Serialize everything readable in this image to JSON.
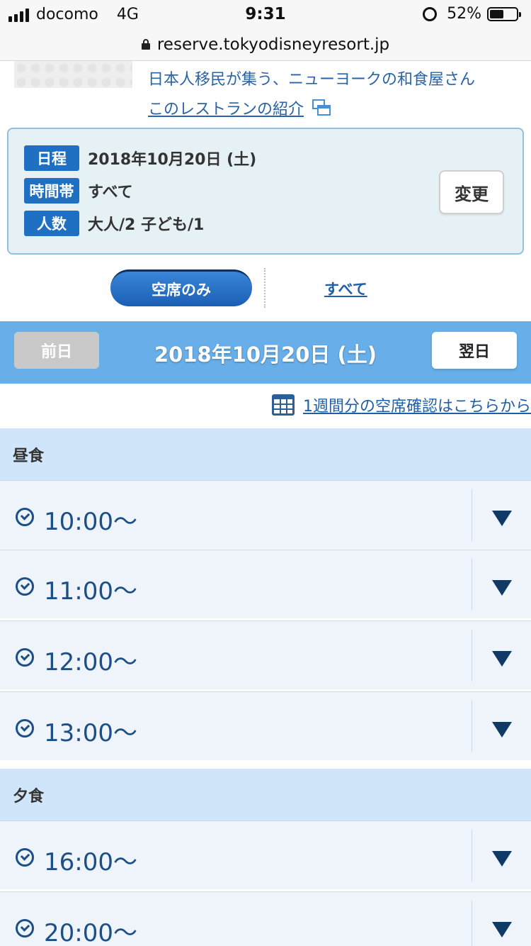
{
  "status_bar": {
    "carrier": "docomo",
    "network": "4G",
    "time": "9:31",
    "battery": "52%",
    "battery_level": 0.52
  },
  "url_bar": {
    "url": "reserve.tokyodisneyresort.jp"
  },
  "restaurant": {
    "description": "日本人移民が集う、ニューヨークの和食屋さん",
    "intro_link": "このレストランの紹介"
  },
  "conditions": {
    "date_label": "日程",
    "date_value": "2018年10月20日 (土)",
    "time_label": "時間帯",
    "time_value": "すべて",
    "party_label": "人数",
    "party_value": "大人/2 子ども/1",
    "change_button": "変更"
  },
  "filter": {
    "available_only": "空席のみ",
    "all": "すべて"
  },
  "date_nav": {
    "prev": "前日",
    "current": "2018年10月20日 (土)",
    "next": "翌日"
  },
  "weekly_link": "1週間分の空席確認はこちらから",
  "sections": [
    {
      "title": "昼食",
      "slots": [
        "10:00〜",
        "11:00〜",
        "12:00〜",
        "13:00〜"
      ]
    },
    {
      "title": "夕食",
      "slots": [
        "16:00〜",
        "20:00〜"
      ]
    }
  ],
  "colors": {
    "accent": "#1f6fc2",
    "date_bar": "#68aee8",
    "section_header": "#cfe5fa",
    "slot_bg": "#eef4fa",
    "time_text": "#1c4f86"
  },
  "icons": {
    "lock": "lock-icon",
    "external_window": "window-icon",
    "calendar": "calendar-icon",
    "clock": "clock-icon",
    "expand": "triangle-down-icon"
  }
}
